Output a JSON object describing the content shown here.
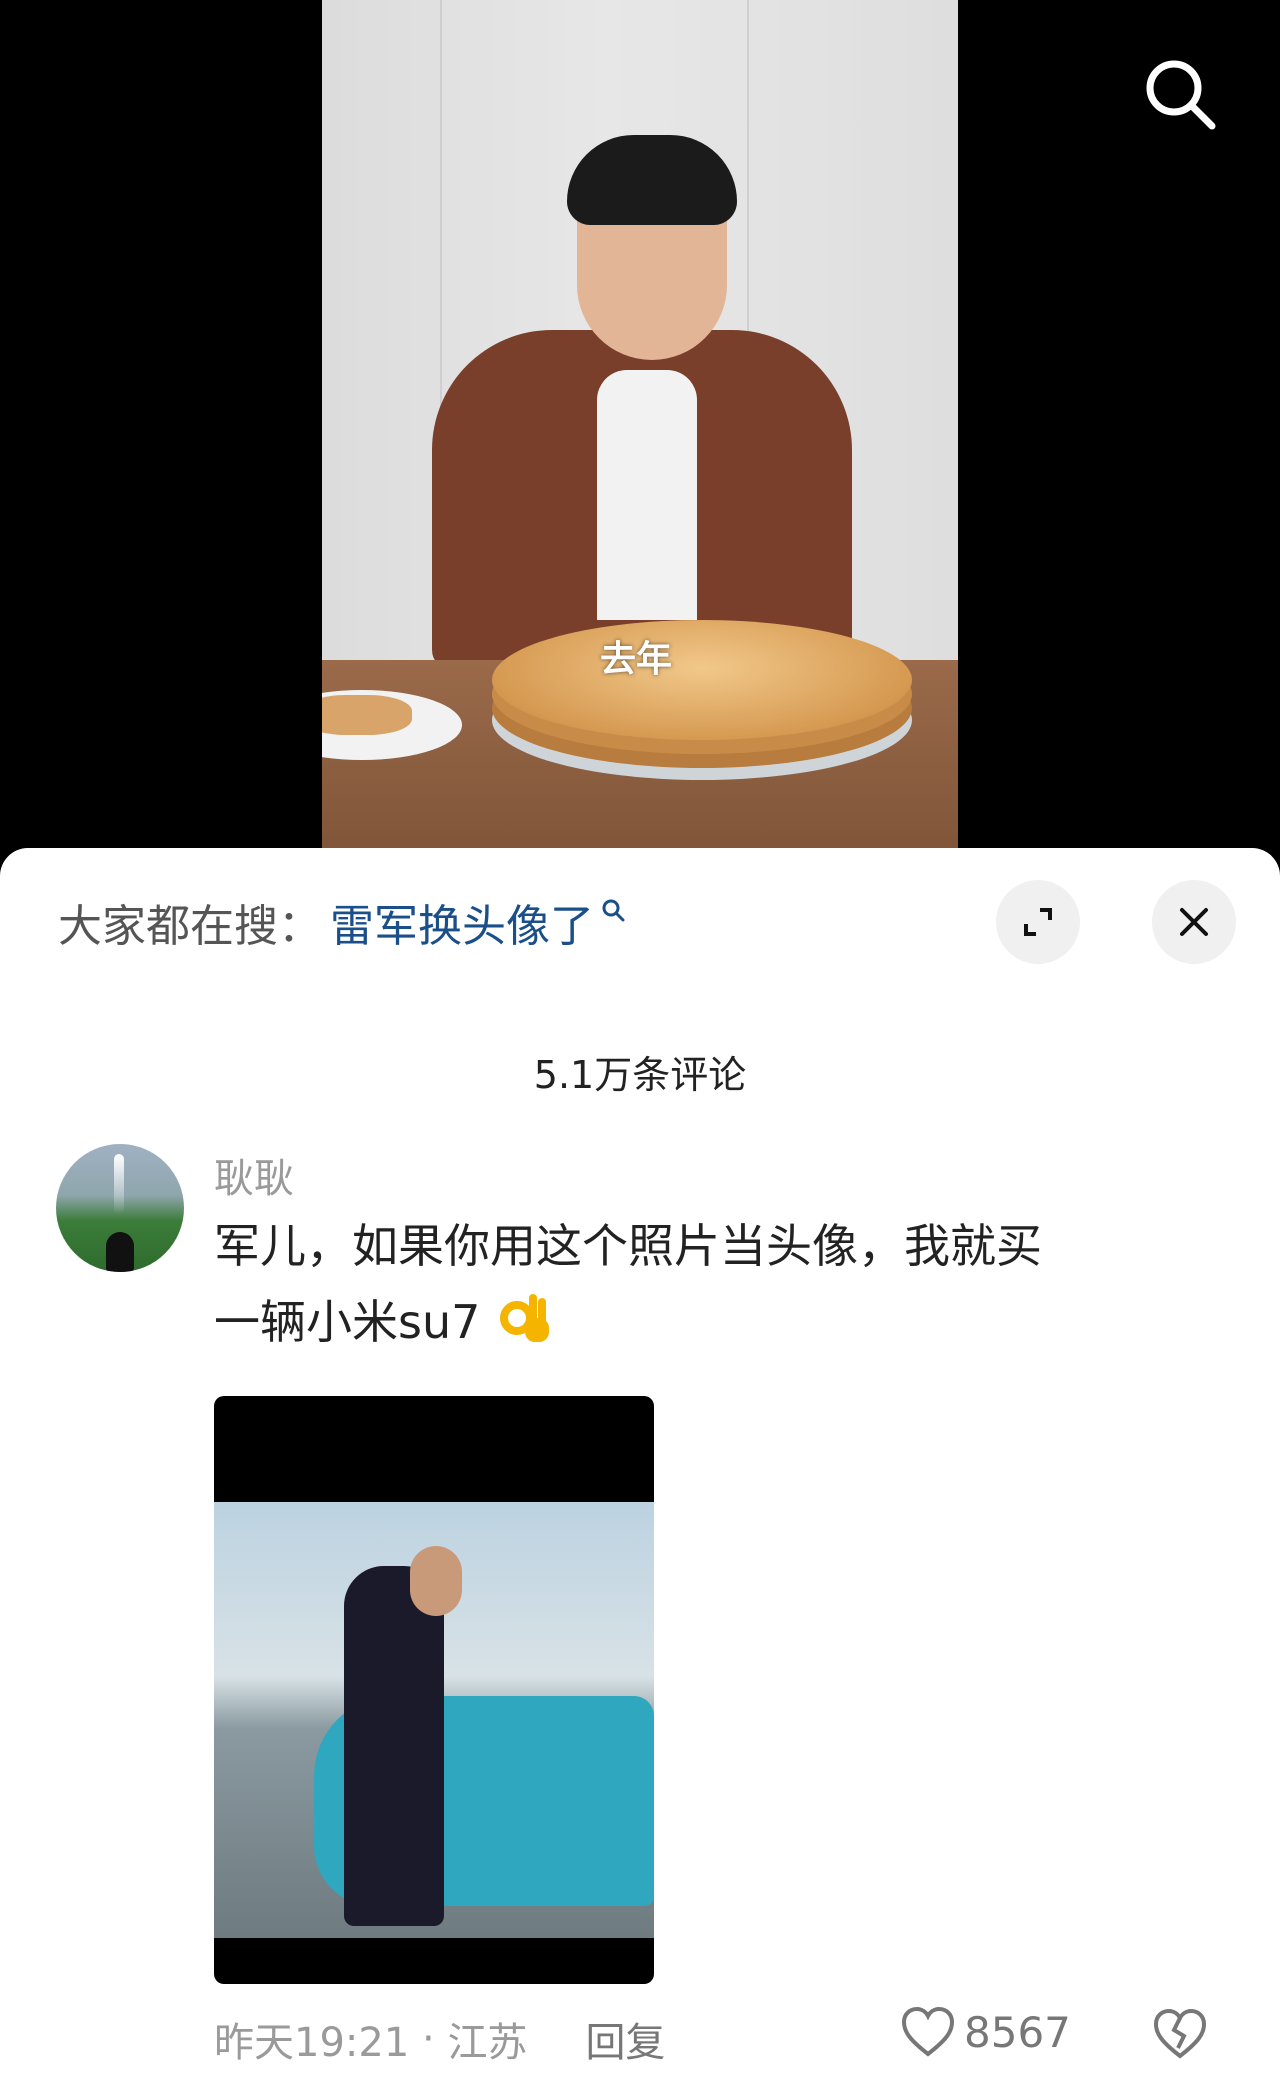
{
  "video": {
    "caption": "去年",
    "search_icon": "search-icon"
  },
  "sheet": {
    "suggest_label": "大家都在搜：",
    "suggest_term": "雷军换头像了",
    "comment_count": "5.1万条评论"
  },
  "comment": {
    "username": "耿耿",
    "text_line1": "军儿，如果你用这个照片当头像，我就买",
    "text_line2": "一辆小米su7",
    "emoji": "ok-hand-emoji",
    "time": "昨天19:21",
    "separator": " · ",
    "location": "江苏",
    "reply_label": "回复",
    "likes": "8567"
  },
  "colors": {
    "link_blue": "#1a4f8a",
    "muted_gray": "#9a9a9a"
  }
}
